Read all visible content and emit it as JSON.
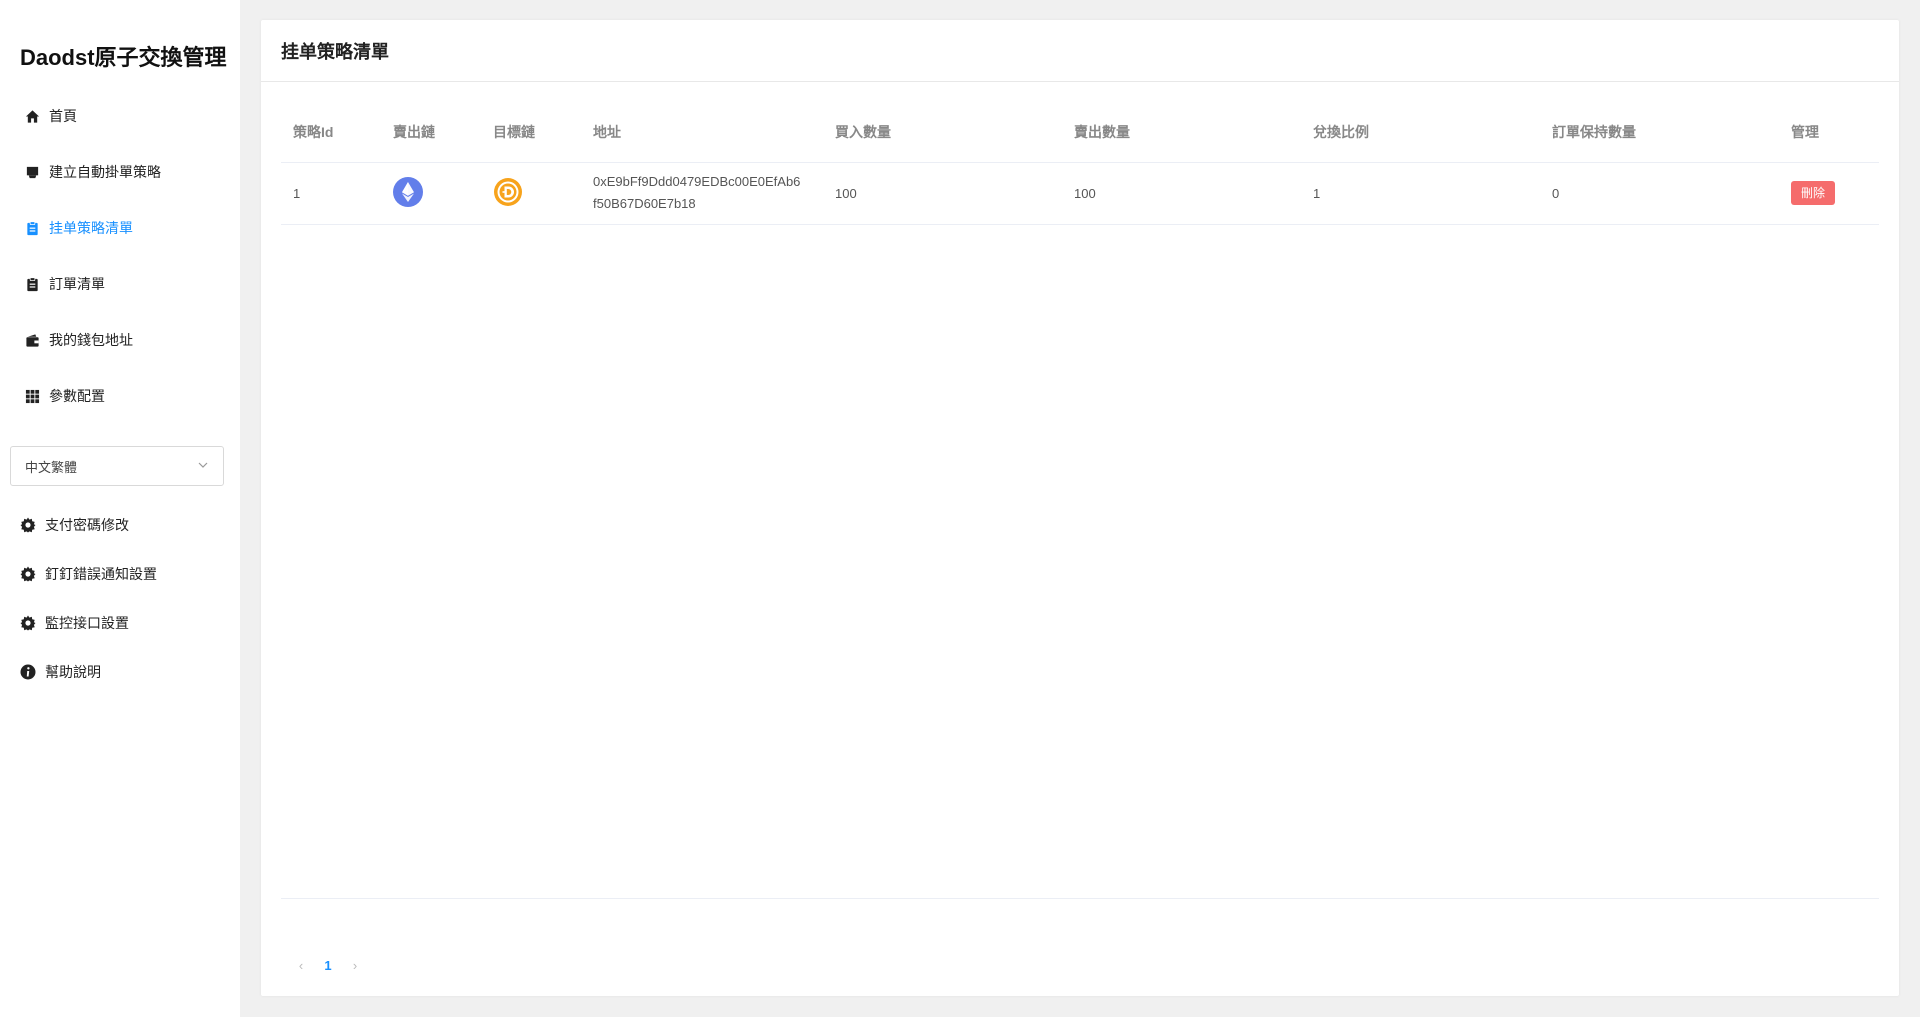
{
  "app": {
    "title": "Daodst原子交換管理"
  },
  "sidebar": {
    "nav": [
      {
        "label": "首頁",
        "icon": "home-icon"
      },
      {
        "label": "建立自動掛單策略",
        "icon": "inbox-icon"
      },
      {
        "label": "挂单策略清單",
        "icon": "clipboard-icon",
        "active": true
      },
      {
        "label": "訂單清單",
        "icon": "clipboard-list-icon"
      },
      {
        "label": "我的錢包地址",
        "icon": "wallet-icon"
      },
      {
        "label": "參數配置",
        "icon": "grid-icon"
      }
    ],
    "language": {
      "selected": "中文繁體"
    },
    "settings": [
      {
        "label": "支付密碼修改",
        "icon": "gear-icon"
      },
      {
        "label": "釘釘錯誤通知設置",
        "icon": "gear-icon"
      },
      {
        "label": "監控接口設置",
        "icon": "gear-icon"
      },
      {
        "label": "幫助說明",
        "icon": "info-icon"
      }
    ]
  },
  "main": {
    "title": "挂单策略清單",
    "table": {
      "columns": [
        "策略Id",
        "賣出鏈",
        "目標鏈",
        "地址",
        "買入數量",
        "賣出數量",
        "兌換比例",
        "訂單保持數量",
        "管理"
      ],
      "rows": [
        {
          "id": "1",
          "sell_chain_icon": "ethereum-icon",
          "target_chain_icon": "dst-coin-icon",
          "address": "0xE9bFf9Ddd0479EDBc00E0EfAb6f50B67D60E7b18",
          "buy_amount": "100",
          "sell_amount": "100",
          "ratio": "1",
          "keep_count": "0",
          "action_label": "刪除"
        }
      ]
    },
    "pagination": {
      "prev": "‹",
      "current": "1",
      "next": "›"
    }
  },
  "colors": {
    "accent": "#1890ff",
    "danger": "#f56c6c",
    "eth": "#627eea",
    "dst": "#f7a31c"
  }
}
